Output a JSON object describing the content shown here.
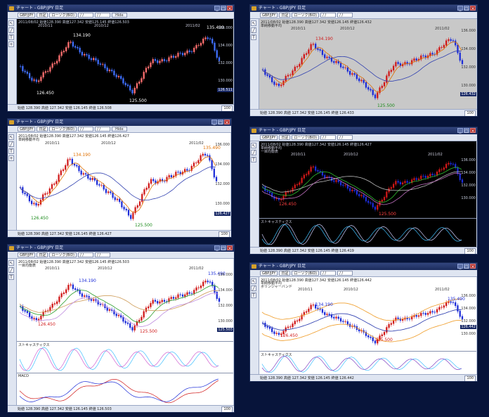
{
  "app": {
    "window_title": "チャート - GBP/JPY 日足"
  },
  "toolbar": {
    "symbol": "GBP/JPY",
    "period": "日足",
    "chart_type": "ローソク(BID)",
    "date_from": "/ /",
    "date_to": "/ /",
    "button": "Hide"
  },
  "toolbar_short": {
    "button": "Hide"
  },
  "ohlc": {
    "w1": "2011/08/02  始値128.390  高値127.342  安値125.145  終値126.503",
    "w2": "2011/08/02  始値128.390  高値127.342  安値126.145  終値126.432",
    "w3": "2011/08/02  始値128.390  高値127.342  安値126.145  終値126.427",
    "w4": "2011/08/02  始値128.390  高値127.342  安値126.145  終値126.427",
    "w5": "2011/08/02  始値128.390  高値127.342  安値126.145  終値126.503",
    "w6": "2011/08/02  始値128.390  高値127.342  安値126.145  終値126.442"
  },
  "labels": {
    "sma": "単純移動平均",
    "ichimoku": "一目均衡表",
    "bollinger": "ボリンジャーバンド",
    "stochastics": "ストキャスティクス",
    "macd": "MACD"
  },
  "months": [
    "2010/11",
    "2010/12",
    "2011/02"
  ],
  "price_labels": {
    "high1": "134.190",
    "low1": "126.450",
    "low2": "125.500",
    "high2": "135.490"
  },
  "ticks": {
    "w1": [
      "136.000",
      "134.000",
      "132.000",
      "130.000",
      "128.000"
    ],
    "w2": [
      "136.000",
      "134.000",
      "132.000",
      "130.000",
      "128.000"
    ],
    "w3": [
      "136.000",
      "134.000",
      "132.000",
      "130.000",
      "128.000"
    ],
    "w4": [
      "136.000",
      "134.000",
      "132.000",
      "130.000",
      "128.000"
    ],
    "w5": [
      "136.000",
      "134.000",
      "132.000",
      "130.000"
    ],
    "w6": [
      "136.000",
      "134.000",
      "132.000",
      "130.000"
    ]
  },
  "last_price": {
    "w1": "126.511",
    "w2": "126.432",
    "w3": "126.427",
    "w5": "125.503",
    "w6": "126.442"
  },
  "status": {
    "w1": "始値 128.390   高値 127.342   安値 126.145   終値 126.508",
    "w2": "始値 128.390   高値 127.342   安値 126.145   終値 126.433",
    "w3": "始値 128.390   高値 127.342   安値 126.145   終値 126.427",
    "w4": "始値 128.390   高値 127.342   安値 126.145   終値 126.419",
    "w5": "始値 128.390   高値 127.342   安値 126.145   終値 126.503",
    "w6": "始値 128.390   高値 127.342   安値 126.145   終値 126.442"
  },
  "zoom": "100",
  "colors": {
    "desktop": "#07143a",
    "up": "#d01818",
    "down": "#1c2cd8",
    "ma_short": "#e07000",
    "ma_long": "#3040b0"
  },
  "icons": [
    "app-icon",
    "minimize-icon",
    "maximize-icon",
    "close-icon",
    "cursor-icon",
    "line-tool-icon",
    "text-tool-icon",
    "zoom-icon"
  ]
}
